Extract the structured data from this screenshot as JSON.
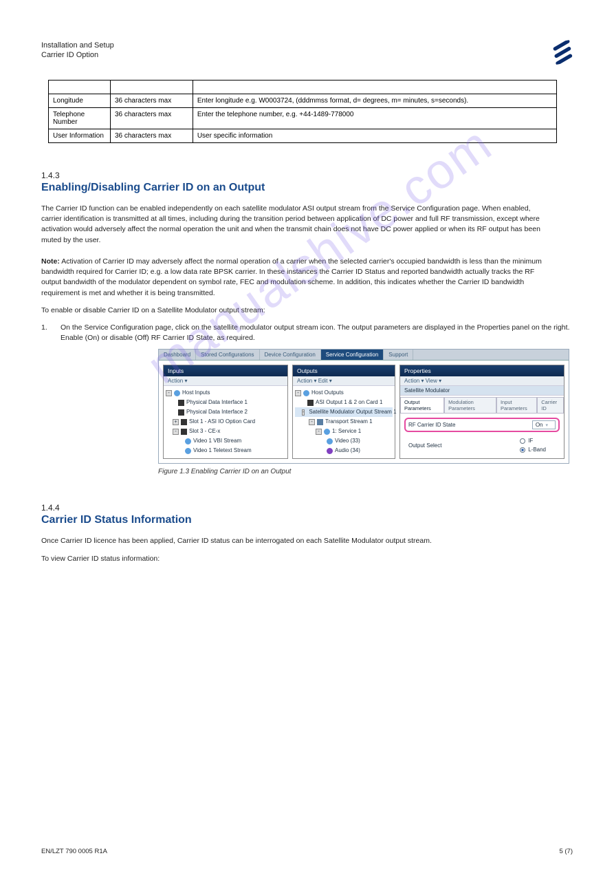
{
  "header": {
    "doc_title_line1": "Installation and Setup",
    "doc_title_line2": "Carrier ID Option"
  },
  "spec_table": {
    "rows": [
      {
        "c0": "",
        "c1": "",
        "c2": ""
      },
      {
        "c0": "Longitude",
        "c1": "36 characters max",
        "c2": "Enter longitude e.g. W0003724, (dddmmss format, d= degrees, m= minutes, s=seconds)."
      },
      {
        "c0": "Telephone Number",
        "c1": "36 characters max",
        "c2": "Enter the telephone number, e.g. +44-1489-778000"
      },
      {
        "c0": "User Information",
        "c1": "36 characters max",
        "c2": "User specific information"
      }
    ]
  },
  "sect3": {
    "num": "1.4.3",
    "title": "Enabling/Disabling Carrier ID on an Output",
    "p1": "The Carrier ID function can be enabled independently on each satellite modulator ASI output stream from the Service Configuration page. When enabled, carrier identification is transmitted at all times, including during the transition period between application of DC power and full RF transmission, except where activation would adversely affect the normal operation the unit and when the transmit chain does not have DC power applied or when its RF output has been muted by the user.",
    "note_label": "Note:",
    "note_text": "Activation of Carrier ID may adversely affect the normal operation of a carrier when the selected carrier's occupied bandwidth is less than the minimum bandwidth required for Carrier ID; e.g. a low data rate BPSK carrier. In these instances the Carrier ID Status and reported bandwidth actually tracks the RF output bandwidth of the modulator dependent on symbol rate, FEC and modulation scheme. In addition, this indicates whether the Carrier ID bandwidth requirement is met and whether it is being transmitted.",
    "p2": "To enable or disable Carrier ID on a Satellite Modulator output stream:",
    "step1_num": "1.",
    "step1_txt": "On the Service Configuration page, click on the satellite modulator output stream icon. The output parameters are displayed in the Properties panel on the right. Enable (On) or disable (Off) RF Carrier ID State, as required."
  },
  "ui": {
    "tabs": {
      "dashboard": "Dashboard",
      "stored": "Stored Configurations",
      "device": "Device Configuration",
      "service": "Service Configuration",
      "support": "Support"
    },
    "inputs": {
      "title": "Inputs",
      "action": "Action ▾",
      "root": "Host Inputs",
      "items": {
        "pdi1": "Physical Data Interface 1",
        "pdi2": "Physical Data Interface 2",
        "slot1": "Slot 1 - ASI IO Option Card",
        "slot3": "Slot 3 - CE-x",
        "vbi": "Video 1 VBI Stream",
        "ttx": "Video 1 Teletext Stream"
      }
    },
    "outputs": {
      "title": "Outputs",
      "action": "Action ▾   Edit ▾",
      "root": "Host Outputs",
      "items": {
        "asi": "ASI Output 1 & 2 on Card 1",
        "sat": "Satellite Modulator Output Stream 1",
        "ts": "Transport Stream 1",
        "svc": "1: Service 1",
        "vid": "Video (33)",
        "aud": "Audio (34)"
      }
    },
    "props": {
      "title": "Properties",
      "action": "Action ▾   View ▾",
      "group": "Satellite Modulator",
      "subtabs": {
        "out": "Output Parameters",
        "mod": "Modulation Parameters",
        "inp": "Input Parameters",
        "cid": "Carrier ID"
      },
      "rf_label": "RF Carrier ID State",
      "rf_value": "On",
      "out_select": "Output Select",
      "if": "IF",
      "lband": "L-Band"
    }
  },
  "fig": {
    "caption": "Figure 1.3   Enabling Carrier ID on an Output"
  },
  "sect4": {
    "num": "1.4.4",
    "title": "Carrier ID Status Information",
    "p1": "Once Carrier ID licence has been applied, Carrier ID status can be interrogated on each Satellite Modulator output stream.",
    "p2": "To view Carrier ID status information:"
  },
  "footer": {
    "left": "EN/LZT 790 0005 R1A",
    "right": "5 (7)"
  },
  "watermark": "manualshive.com"
}
